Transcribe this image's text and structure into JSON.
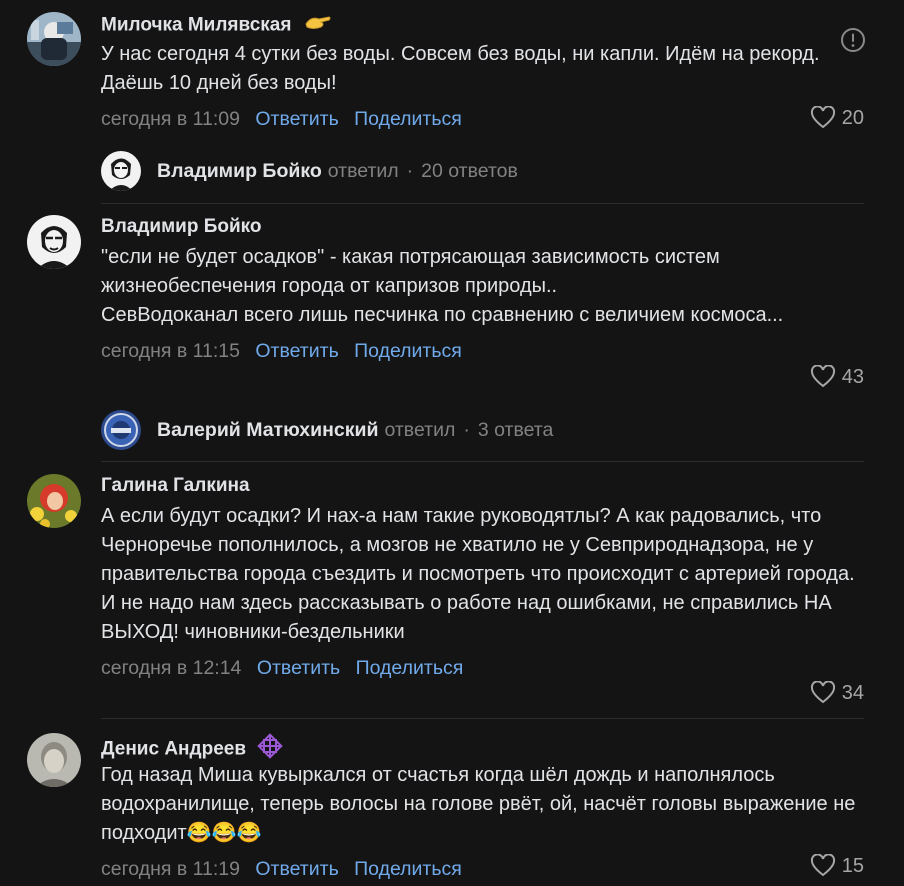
{
  "comments": [
    {
      "author": "Милочка Милявская",
      "badge_icon": "pinching-hand-emoji",
      "text": "У нас сегодня 4 сутки без воды. Совсем без воды, ни капли. Идём на рекорд. Даёшь 10 дней без воды!",
      "time": "сегодня в 11:09",
      "reply_label": "Ответить",
      "share_label": "Поделиться",
      "likes": "20"
    },
    {
      "author": "Владимир Бойко",
      "text": "\"если не будет осадков\" - какая потрясающая зависимость систем жизнеобеспечения города от капризов природы..\nСевВодоканал всего лишь песчинка по сравнению с величием космоса...",
      "time": "сегодня в 11:15",
      "reply_label": "Ответить",
      "share_label": "Поделиться",
      "likes": "43"
    },
    {
      "author": "Галина Галкина",
      "text": "А если будут осадки? И нах-а нам такие руководятлы? А как радовались, что Черноречье пополнилось, а мозгов не хватило не у Севприроднадзора, не у правительства города съездить и посмотреть что происходит с артерией города. И не надо нам здесь рассказывать о работе над ошибками, не справились НА ВЫХОД! чиновники-бездельники",
      "time": "сегодня в 12:14",
      "reply_label": "Ответить",
      "share_label": "Поделиться",
      "likes": "34"
    },
    {
      "author": "Денис Андреев",
      "badge_icon": "purple-knot-badge-icon",
      "text": "Год назад Миша кувыркался от счастья когда шёл дождь и наполнялось водохранилище, теперь волосы на голове рвёт, ой, насчёт головы выражение не подходит😂😂😂",
      "time": "сегодня в 11:19",
      "reply_label": "Ответить",
      "share_label": "Поделиться",
      "likes": "15"
    }
  ],
  "threads": [
    {
      "name": "Владимир Бойко",
      "action": "ответил",
      "count": "20 ответов"
    },
    {
      "name": "Валерий Матюхинский",
      "action": "ответил",
      "count": "3 ответа"
    }
  ],
  "colors": {
    "background": "#141414",
    "link": "#71aaeb",
    "muted": "#828282",
    "text": "#e1e3e6"
  }
}
